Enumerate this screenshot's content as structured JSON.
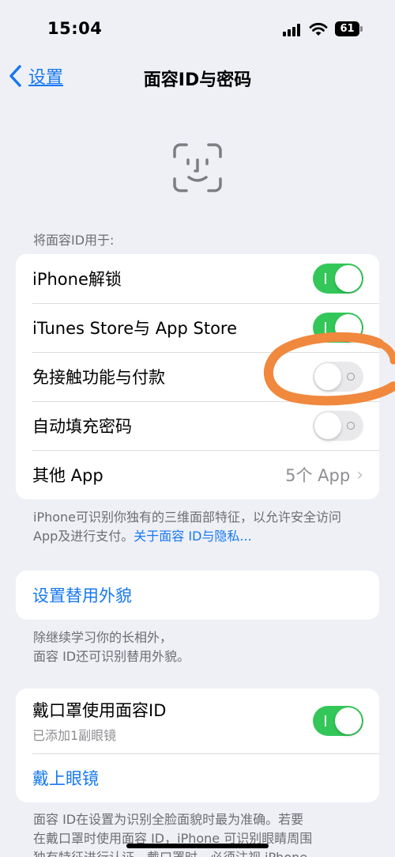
{
  "status_bar": {
    "time": "15:04",
    "battery": "61"
  },
  "nav": {
    "back_label": "设置",
    "title": "面容ID与密码"
  },
  "section1": {
    "header": "将面容ID用于:",
    "rows": [
      {
        "label": "iPhone解锁",
        "toggle": "on"
      },
      {
        "label": "iTunes Store与 App Store",
        "toggle": "on"
      },
      {
        "label": "免接触功能与付款",
        "toggle": "off"
      },
      {
        "label": "自动填充密码",
        "toggle": "off"
      },
      {
        "label": "其他 App",
        "value": "5个 App"
      }
    ],
    "footer": "iPhone可识别你独有的三维面部特征，以允许安全访问 App及进行支付。",
    "footer_link": "关于面容 ID与隐私..."
  },
  "section2": {
    "row_label": "设置替用外貌",
    "footer_line1": "除继续学习你的长相外，",
    "footer_line2": "面容 ID还可识别替用外貌。"
  },
  "section3": {
    "mask_label": "戴口罩使用面容ID",
    "mask_sub": "已添加1副眼镜",
    "mask_toggle": "on",
    "glasses_label": "戴上眼镜",
    "footer_line1": "面容 ID在设置为识别全脸面貌时最为准确。若要",
    "footer_line2": "在戴口罩时使用面容 ID，iPhone 可识别眼睛周围",
    "footer_line3": "独有特征进行认证。戴口罩时，必须注视 iPhone"
  },
  "colors": {
    "accent": "#1778f2",
    "toggle_on": "#33c759",
    "annotation": "#f0883e"
  }
}
